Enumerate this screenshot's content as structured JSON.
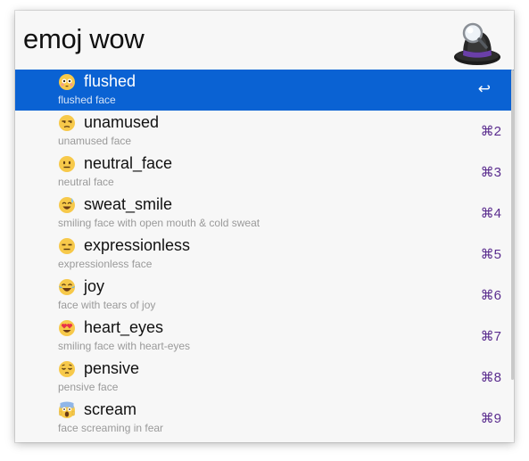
{
  "search": {
    "query": "emoj wow"
  },
  "app": {
    "logo_icon": "alfred-hat-icon"
  },
  "colors": {
    "selection": "#0a62d3",
    "shortcut": "#5a2c8e"
  },
  "results": [
    {
      "emoji": "😳",
      "icon": "flushed-face-icon",
      "title": "flushed",
      "subtitle": "flushed face",
      "shortcut": "↩"
    },
    {
      "emoji": "😒",
      "icon": "unamused-face-icon",
      "title": "unamused",
      "subtitle": "unamused face",
      "shortcut": "⌘2"
    },
    {
      "emoji": "😐",
      "icon": "neutral-face-icon",
      "title": "neutral_face",
      "subtitle": "neutral face",
      "shortcut": "⌘3"
    },
    {
      "emoji": "😅",
      "icon": "sweat-smile-face-icon",
      "title": "sweat_smile",
      "subtitle": "smiling face with open mouth & cold sweat",
      "shortcut": "⌘4"
    },
    {
      "emoji": "😑",
      "icon": "expressionless-face-icon",
      "title": "expressionless",
      "subtitle": "expressionless face",
      "shortcut": "⌘5"
    },
    {
      "emoji": "😂",
      "icon": "joy-face-icon",
      "title": "joy",
      "subtitle": "face with tears of joy",
      "shortcut": "⌘6"
    },
    {
      "emoji": "😍",
      "icon": "heart-eyes-face-icon",
      "title": "heart_eyes",
      "subtitle": "smiling face with heart-eyes",
      "shortcut": "⌘7"
    },
    {
      "emoji": "😔",
      "icon": "pensive-face-icon",
      "title": "pensive",
      "subtitle": "pensive face",
      "shortcut": "⌘8"
    },
    {
      "emoji": "😱",
      "icon": "scream-face-icon",
      "title": "scream",
      "subtitle": "face screaming in fear",
      "shortcut": "⌘9"
    }
  ]
}
